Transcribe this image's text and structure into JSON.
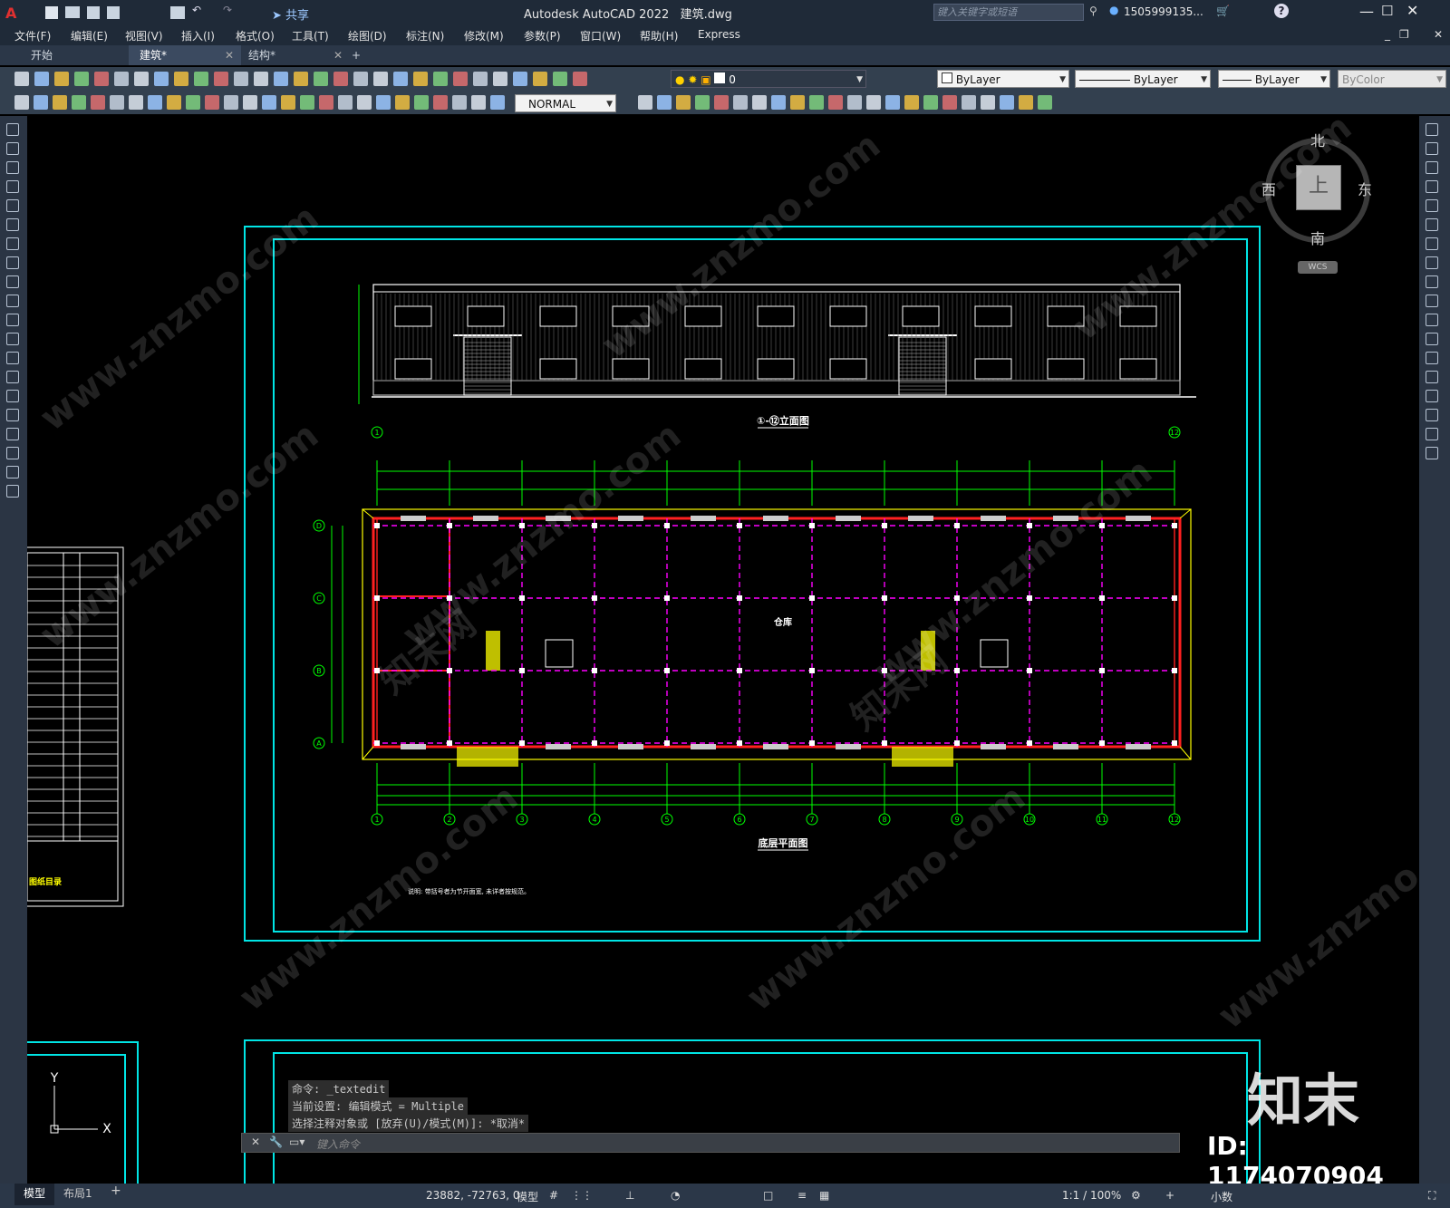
{
  "title": {
    "app": "Autodesk AutoCAD 2022",
    "file": "建筑.dwg",
    "search_placeholder": "键入关键字或短语",
    "user": "1505999135...",
    "share": "共享"
  },
  "menu": [
    "文件(F)",
    "编辑(E)",
    "视图(V)",
    "插入(I)",
    "格式(O)",
    "工具(T)",
    "绘图(D)",
    "标注(N)",
    "修改(M)",
    "参数(P)",
    "窗口(W)",
    "帮助(H)",
    "Express"
  ],
  "tabs": [
    {
      "label": "开始"
    },
    {
      "label": "建筑*"
    },
    {
      "label": "结构*"
    }
  ],
  "toolbar": {
    "layer_value": "0",
    "color_value": "ByLayer",
    "linetype_value": "ByLayer",
    "lineweight_value": "ByLayer",
    "plotstyle_value": "ByColor",
    "dimstyle_value": "NORMAL"
  },
  "viewcube": {
    "north": "北",
    "south": "南",
    "east": "东",
    "west": "西",
    "top": "上",
    "wcs": "WCS"
  },
  "drawing": {
    "elevation_title": "①-⑫立面图",
    "plan_title": "底层平面图",
    "plan_room": "仓库",
    "plan_note": "说明: 带括号者为节开面宽, 未详者按规范。",
    "grid_letters": [
      "D",
      "C",
      "B",
      "A"
    ],
    "grid_numbers_top": [
      "1",
      "12"
    ],
    "grid_numbers_bottom": [
      "1",
      "2",
      "3",
      "4",
      "5",
      "6",
      "7",
      "8",
      "9",
      "10",
      "11",
      "12"
    ],
    "sheet_index_title": "图纸目录"
  },
  "command": {
    "line1": "命令: _textedit",
    "line2": "当前设置: 编辑模式 = Multiple",
    "line3": "选择注释对象或 [放弃(U)/模式(M)]: *取消*",
    "placeholder": "键入命令"
  },
  "status": {
    "model_tab": "模型",
    "layout_tab": "布局1",
    "coords": "23882, -72763, 0",
    "model": "模型",
    "scale": "1:1 / 100%",
    "units": "小数"
  },
  "watermark": {
    "site": "www.znzmo.com",
    "brand_cn": "知末网",
    "logo": "知末",
    "id": "ID: 1174070904"
  },
  "colors": {
    "titlebar": "#1f2a38",
    "toolbar": "#33404f",
    "cyan": "#00e5e5",
    "green": "#00ff00",
    "magenta": "#ff00ff",
    "red": "#ff2020",
    "yellow": "#ffff33"
  }
}
